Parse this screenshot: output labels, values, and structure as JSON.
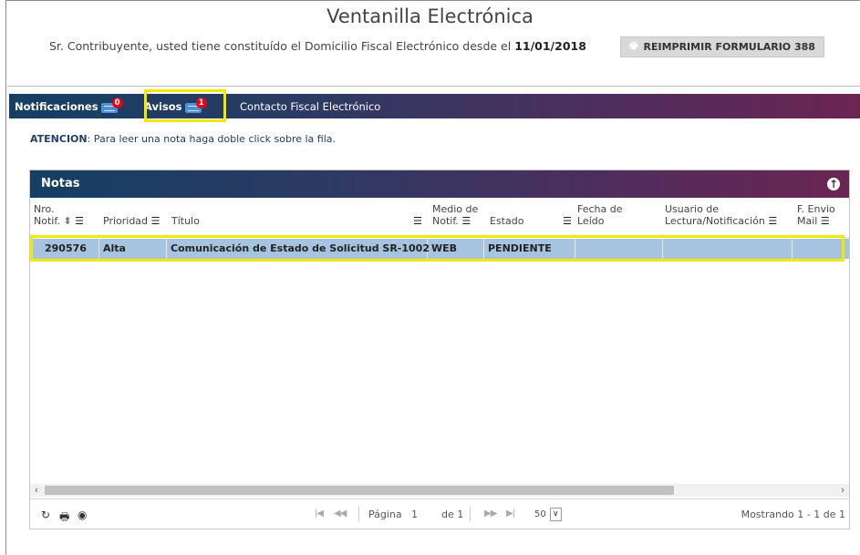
{
  "header": {
    "title": "Ventanilla Electrónica",
    "subtitle_prefix": "Sr. Contribuyente, usted tiene constituído el Domicilio Fiscal Electrónico desde el",
    "subtitle_date": "11/01/2018",
    "reprint_button": "REIMPRIMIR FORMULARIO 388"
  },
  "tabs": [
    {
      "label": "Notificaciones",
      "badge": "0"
    },
    {
      "label": "Avisos",
      "badge": "1"
    },
    {
      "label": "Contacto Fiscal Electrónico"
    }
  ],
  "notice": {
    "label": "ATENCION",
    "text": ": Para leer una nota haga doble click sobre la fila."
  },
  "grid": {
    "caption": "Notas",
    "columns": [
      {
        "line1": "Nro.",
        "line2": "Notif."
      },
      {
        "line1": "",
        "line2": "Prioridad"
      },
      {
        "line1": "",
        "line2": "Título"
      },
      {
        "line1": "Medio de",
        "line2": "Notif."
      },
      {
        "line1": "",
        "line2": "Estado"
      },
      {
        "line1": "Fecha de",
        "line2": "Leído"
      },
      {
        "line1": "Usuario de",
        "line2": "Lectura/Notificación"
      },
      {
        "line1": "F. Envio",
        "line2": "Mail"
      }
    ],
    "rows": [
      {
        "nro": "290576",
        "prioridad": "Alta",
        "titulo": "Comunicación de Estado de Solicitud SR-1002",
        "medio": "WEB",
        "estado": "PENDIENTE",
        "fecha": "",
        "usuario": "",
        "envio": ""
      }
    ]
  },
  "pager": {
    "page_label": "Página",
    "page_value": "1",
    "of_label": "de 1",
    "rows_per_page": "50",
    "status": "Mostrando 1 - 1 de 1"
  },
  "colors": {
    "bar_start": "#143f63",
    "bar_end": "#6b2553",
    "selected_row": "#a6c4e0",
    "highlight": "#f5e800",
    "badge": "#e20613"
  }
}
